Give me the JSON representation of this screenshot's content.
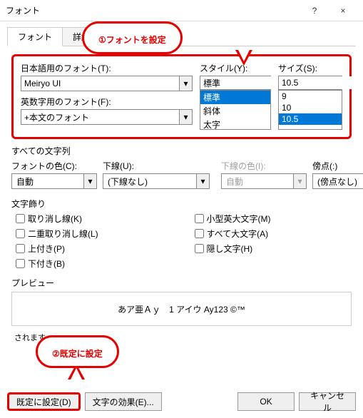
{
  "window": {
    "title": "フォント",
    "help": "?",
    "close": "×"
  },
  "tabs": {
    "font": "フォント",
    "advanced": "詳細設定"
  },
  "callouts": {
    "c1_num": "①",
    "c1_text": "フォントを設定",
    "c2_num": "②",
    "c2_text": "既定に設定"
  },
  "labels": {
    "jpFont": "日本語用のフォント(T):",
    "enFont": "英数字用のフォント(F):",
    "style": "スタイル(Y):",
    "size": "サイズ(S):",
    "allText": "すべての文字列",
    "fontColor": "フォントの色(C):",
    "underline": "下線(U):",
    "underlineColor": "下線の色(I):",
    "emphasis": "傍点(:)",
    "decor": "文字飾り",
    "preview": "プレビュー"
  },
  "values": {
    "jpFont": "Meiryo UI",
    "enFont": "+本文のフォント",
    "style": "標準",
    "size": "10.5",
    "fontColor": "自動",
    "underline": "(下線なし)",
    "underlineColor": "自動",
    "emphasis": "(傍点なし)"
  },
  "styleList": [
    "標準",
    "斜体",
    "太字"
  ],
  "sizeList": [
    "9",
    "10",
    "10.5"
  ],
  "checks": {
    "strike": "取り消し線(K)",
    "dblstrike": "二重取り消し線(L)",
    "super": "上付き(P)",
    "sub": "下付き(B)",
    "smallcaps": "小型英大文字(M)",
    "allcaps": "すべて大文字(A)",
    "hidden": "隠し文字(H)"
  },
  "previewText": "あア亜Ａｙ　1  アイウ Ay123 ©™",
  "note": "されます。",
  "buttons": {
    "default": "既定に設定(D)",
    "effects": "文字の効果(E)...",
    "ok": "OK",
    "cancel": "キャンセル"
  }
}
